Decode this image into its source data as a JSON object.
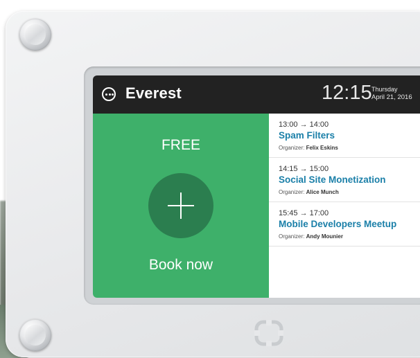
{
  "room": {
    "name": "Everest",
    "time": "12:15",
    "day": "Thursday",
    "date": "April 21, 2016"
  },
  "status": {
    "label": "FREE",
    "book_label": "Book now",
    "color": "#3eb06a"
  },
  "events": [
    {
      "time": "13:00 → 14:00",
      "title": "Spam Filters",
      "organizer_label": "Organizer:",
      "organizer": "Felix Eskins"
    },
    {
      "time": "14:15 → 15:00",
      "title": "Social Site Monetization",
      "organizer_label": "Organizer:",
      "organizer": "Alice Munch"
    },
    {
      "time": "15:45 → 17:00",
      "title": "Mobile Developers Meetup",
      "organizer_label": "Organizer:",
      "organizer": "Andy Mounier"
    }
  ],
  "icons": {
    "more": "more-options-icon",
    "add": "plus-icon",
    "logo": "brand-logo-icon"
  }
}
